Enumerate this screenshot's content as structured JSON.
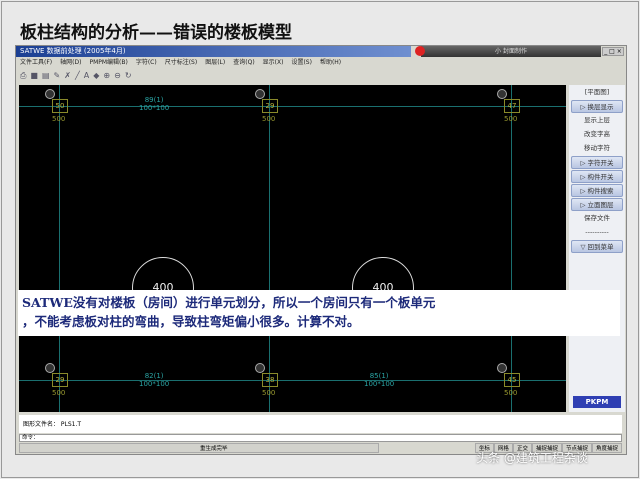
{
  "slide_title": "板柱结构的分析——错误的楼板模型",
  "window": {
    "title": "SATWE 数据前处理 (2005年4月)",
    "notice": "小 封面制作",
    "controls": "_ □ ×"
  },
  "menu": [
    "文件工具(F)",
    "轴网(D)",
    "PMPM编辑(B)",
    "字符(C)",
    "尺寸标注(S)",
    "图层(L)",
    "查询(Q)",
    "显示(X)",
    "设置(S)",
    "帮助(H)"
  ],
  "toolbar_icons": [
    "print",
    "save",
    "open",
    "pen",
    "draw",
    "line",
    "text",
    "fill",
    "zoom-in",
    "zoom-out",
    "refresh"
  ],
  "canvas": {
    "columns": [
      {
        "id": "50",
        "size": "500"
      },
      {
        "id": "29",
        "size": "500"
      },
      {
        "id": "47",
        "size": "500"
      },
      {
        "id": "29",
        "size": "500"
      },
      {
        "id": "38",
        "size": "500"
      },
      {
        "id": "45",
        "size": "500"
      }
    ],
    "beams": [
      {
        "id": "89(1)",
        "size": "100*100"
      },
      {
        "id": "82(1)",
        "size": "100*100"
      },
      {
        "id": "85(1)",
        "size": "100*100"
      }
    ],
    "slabs": [
      "400",
      "400"
    ]
  },
  "panel": {
    "items": [
      {
        "label": "[平面图]",
        "btn": false
      },
      {
        "label": "▷ 换层显示",
        "btn": true
      },
      {
        "label": "显示上层",
        "btn": false
      },
      {
        "label": "改变字高",
        "btn": false
      },
      {
        "label": "移动字符",
        "btn": false
      },
      {
        "label": "▷ 字符开关",
        "btn": true
      },
      {
        "label": "▷ 构件开关",
        "btn": true
      },
      {
        "label": "▷ 构件搜索",
        "btn": true
      },
      {
        "label": "▷ 立面图层",
        "btn": true
      },
      {
        "label": "保存文件",
        "btn": false
      },
      {
        "label": "----------",
        "btn": false
      },
      {
        "label": "▽ 回到菜单",
        "btn": true
      }
    ],
    "logo": "PKPM"
  },
  "overlay": {
    "line1": "SATWE没有对楼板（房间）进行单元划分，所以一个房间只有一个板单元",
    "line2": "，不能考虑板对柱的弯曲，导致柱弯矩偏小很多。计算不对。"
  },
  "command": {
    "file_label": "图形文件名：  PLS1.T",
    "prompt": "命令："
  },
  "status": {
    "main": "重生成完毕",
    "toggles": [
      "坐标",
      "网格",
      "正交",
      "捕捉捕捉",
      "节点捕捉",
      "角度捕捉"
    ]
  },
  "watermark": "头条 @建筑工程杂谈"
}
